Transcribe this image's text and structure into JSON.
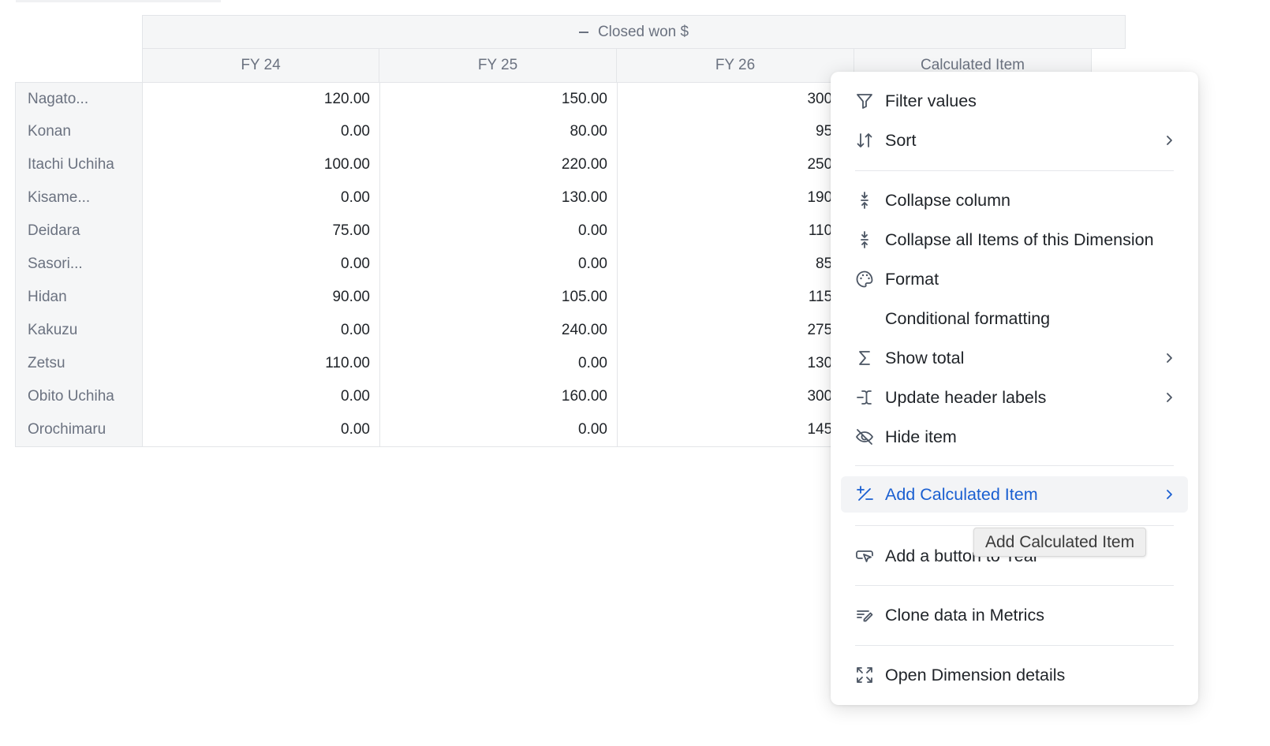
{
  "pivot": {
    "group_header": "Closed won $",
    "columns": [
      "FY 24",
      "FY 25",
      "FY 26",
      "Calculated Item"
    ],
    "rows": [
      {
        "label": "Nagato...",
        "values": [
          "120.00",
          "150.00",
          "300.0",
          ""
        ]
      },
      {
        "label": "Konan",
        "values": [
          "0.00",
          "80.00",
          "95.0",
          ""
        ]
      },
      {
        "label": "Itachi Uchiha",
        "values": [
          "100.00",
          "220.00",
          "250.0",
          ""
        ]
      },
      {
        "label": "Kisame...",
        "values": [
          "0.00",
          "130.00",
          "190.0",
          ""
        ]
      },
      {
        "label": "Deidara",
        "values": [
          "75.00",
          "0.00",
          "110.0",
          ""
        ]
      },
      {
        "label": "Sasori...",
        "values": [
          "0.00",
          "0.00",
          "85.0",
          ""
        ]
      },
      {
        "label": "Hidan",
        "values": [
          "90.00",
          "105.00",
          "115.0",
          ""
        ]
      },
      {
        "label": "Kakuzu",
        "values": [
          "0.00",
          "240.00",
          "275.0",
          ""
        ]
      },
      {
        "label": "Zetsu",
        "values": [
          "110.00",
          "0.00",
          "130.0",
          ""
        ]
      },
      {
        "label": "Obito Uchiha",
        "values": [
          "0.00",
          "160.00",
          "300.0",
          ""
        ]
      },
      {
        "label": "Orochimaru",
        "values": [
          "0.00",
          "0.00",
          "145.0",
          ""
        ]
      }
    ]
  },
  "menu": {
    "items": [
      {
        "label": "Filter values",
        "icon": "filter-icon"
      },
      {
        "label": "Sort",
        "icon": "sort-icon",
        "submenu": true
      },
      {
        "label": "Collapse column",
        "icon": "collapse-icon"
      },
      {
        "label": "Collapse all Items of this Dimension",
        "icon": "collapse-all-icon"
      },
      {
        "label": "Format",
        "icon": "palette-icon"
      },
      {
        "label": "Conditional formatting",
        "icon": ""
      },
      {
        "label": "Show total",
        "icon": "sigma-icon",
        "submenu": true
      },
      {
        "label": "Update header labels",
        "icon": "text-cursor-icon",
        "submenu": true
      },
      {
        "label": "Hide item",
        "icon": "eye-off-icon"
      },
      {
        "label": "Add Calculated Item",
        "icon": "plus-slash-minus-icon",
        "submenu": true,
        "active": true
      },
      {
        "label": "Add a button to Year",
        "icon": "button-pointer-icon"
      },
      {
        "label": "Clone data in Metrics",
        "icon": "clone-data-icon"
      },
      {
        "label": "Open Dimension details",
        "icon": "expand-icon"
      }
    ]
  },
  "tooltip": {
    "text": "Add Calculated Item"
  },
  "colors": {
    "accent": "#1a5fd1",
    "header_bg": "#f5f6f7",
    "border": "#e3e5e8",
    "muted_text": "#6b7280"
  }
}
